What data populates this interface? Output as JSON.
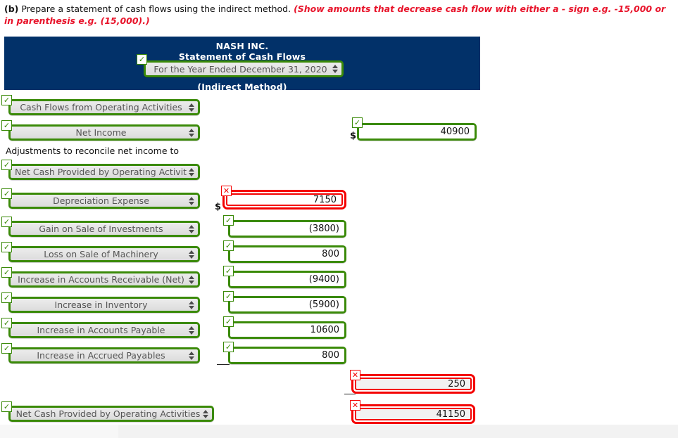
{
  "instruction": {
    "label": "(b)",
    "text": " Prepare a statement of cash flows using the indirect method. ",
    "hint": "(Show amounts that decrease cash flow with either a - sign e.g. -15,000 or in parenthesis e.g. (15,000).)"
  },
  "statement_header": {
    "company": "NASH INC.",
    "title": "Statement of Cash Flows",
    "period": "For the Year Ended December 31, 2020",
    "method": "(Indirect Method)",
    "navy": "#023169",
    "period_status": "correct"
  },
  "icons": {
    "correct": "✓",
    "incorrect": "✕",
    "stepper": "select-stepper-arrows"
  },
  "status_colors": {
    "correct": "#3a8a08",
    "incorrect": "#f40000"
  },
  "rows": [
    {
      "id": "section-operating",
      "label": "Cash Flows from Operating Activities",
      "label_status": "correct",
      "amount": null
    },
    {
      "id": "net-income",
      "label": "Net Income",
      "label_status": "correct",
      "amount": "40900",
      "amount_status": "correct",
      "currency": "$"
    },
    {
      "id": "adjustments-caption",
      "label": "Adjustments to reconcile net income to",
      "type": "static"
    },
    {
      "id": "net-cash-subheading",
      "label": "Net Cash Provided by Operating Activities",
      "label_status": "correct",
      "amount": null
    },
    {
      "id": "depreciation-expense",
      "label": "Depreciation Expense",
      "label_status": "correct",
      "amount": "7150",
      "amount_status": "incorrect",
      "currency": "$"
    },
    {
      "id": "gain-on-sale-of-investments",
      "label": "Gain on Sale of Investments",
      "label_status": "correct",
      "amount": "(3800)",
      "amount_status": "correct"
    },
    {
      "id": "loss-on-sale-of-machinery",
      "label": "Loss on Sale of Machinery",
      "label_status": "correct",
      "amount": "800",
      "amount_status": "correct"
    },
    {
      "id": "increase-in-accounts-receivable",
      "label": "Increase in Accounts Receivable (Net)",
      "label_status": "correct",
      "amount": "(9400)",
      "amount_status": "correct"
    },
    {
      "id": "increase-in-inventory",
      "label": "Increase in Inventory",
      "label_status": "correct",
      "amount": "(5900)",
      "amount_status": "correct"
    },
    {
      "id": "increase-in-accounts-payable",
      "label": "Increase in Accounts Payable",
      "label_status": "correct",
      "amount": "10600",
      "amount_status": "correct"
    },
    {
      "id": "increase-in-accrued-payables",
      "label": "Increase in Accrued Payables",
      "label_status": "correct",
      "amount": "800",
      "amount_status": "correct"
    },
    {
      "id": "adjustments-total",
      "label": null,
      "amount": "250",
      "amount_status": "incorrect"
    },
    {
      "id": "net-cash-provided-total",
      "label": "Net Cash Provided by Operating Activities",
      "label_status": "correct",
      "amount": "41150",
      "amount_status": "incorrect"
    }
  ]
}
